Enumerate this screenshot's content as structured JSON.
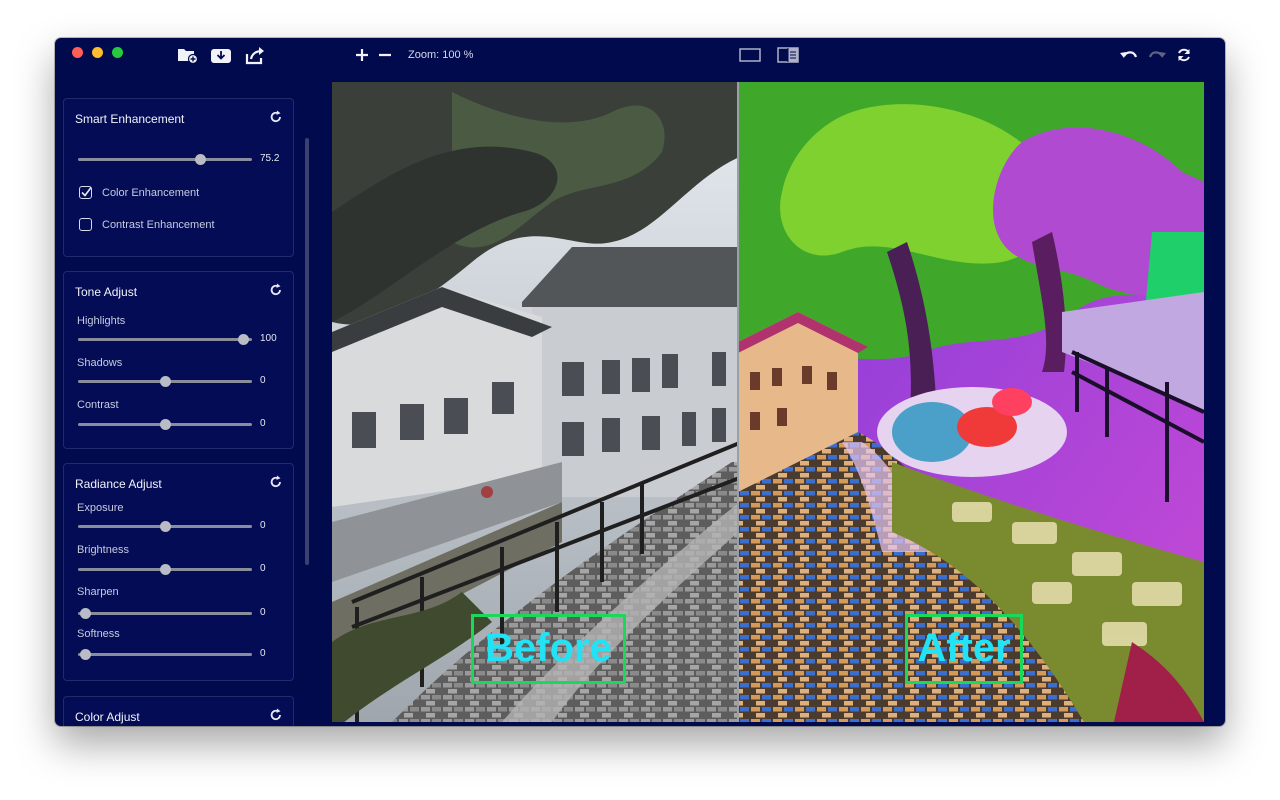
{
  "toolbar": {
    "zoom_label": "Zoom: 100 %",
    "icons": [
      "add-folder-icon",
      "import-icon",
      "export-icon",
      "zoom-in-icon",
      "zoom-out-icon",
      "single-view-icon",
      "split-view-icon",
      "undo-icon",
      "redo-icon",
      "refresh-icon"
    ]
  },
  "panels": {
    "smart": {
      "title": "Smart Enhancement",
      "slider_value": "75.2",
      "slider_fraction": 0.7,
      "color_enhancement": {
        "label": "Color Enhancement",
        "checked": true
      },
      "contrast_enhancement": {
        "label": "Contrast Enhancement",
        "checked": false
      }
    },
    "tone": {
      "title": "Tone Adjust",
      "highlights": {
        "label": "Highlights",
        "value": "100",
        "fraction": 0.95
      },
      "shadows": {
        "label": "Shadows",
        "value": "0",
        "fraction": 0.5
      },
      "contrast": {
        "label": "Contrast",
        "value": "0",
        "fraction": 0.5
      }
    },
    "radiance": {
      "title": "Radiance Adjust",
      "exposure": {
        "label": "Exposure",
        "value": "0",
        "fraction": 0.5
      },
      "brightness": {
        "label": "Brightness",
        "value": "0",
        "fraction": 0.5
      },
      "sharpen": {
        "label": "Sharpen",
        "value": "0",
        "fraction": 0.04
      },
      "softness": {
        "label": "Softness",
        "value": "0",
        "fraction": 0.04
      }
    },
    "color": {
      "title": "Color Adjust"
    }
  },
  "preview": {
    "before_label": "Before",
    "after_label": "After"
  },
  "colors": {
    "window_bg": "#020a4e",
    "label_border": "#19d85a",
    "label_text": "#21e3f5"
  }
}
